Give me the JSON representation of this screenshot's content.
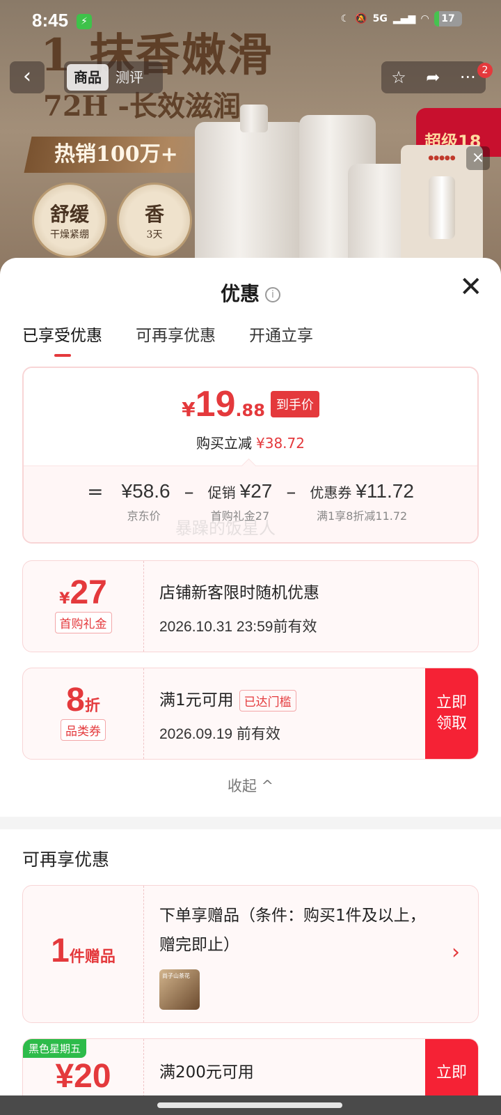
{
  "status_bar": {
    "time": "8:45",
    "network": "5G",
    "battery": "17",
    "battery_level": 0.17
  },
  "banner": {
    "headline": "1 抹香嫩滑",
    "subline": "72H -长效滋润",
    "ribbon": "热销100万+",
    "badge1_big": "舒缓",
    "badge1_small": "干燥紧绷",
    "badge2_big": "香",
    "badge2_small": "3天",
    "red_tag": "超级18"
  },
  "nav": {
    "tabs": [
      {
        "label": "商品"
      },
      {
        "label": "测评"
      }
    ],
    "cart_badge": "2"
  },
  "sheet": {
    "title": "优惠",
    "tabs": [
      {
        "label": "已享受优惠"
      },
      {
        "label": "可再享优惠"
      },
      {
        "label": "开通立享"
      }
    ]
  },
  "summary": {
    "currency": "¥",
    "price_int": "19",
    "price_dec": ".88",
    "price_tag": "到手价",
    "reduce_label": "购买立减",
    "reduce_value": "¥38.72",
    "equals": "=",
    "minus": "–",
    "terms": [
      {
        "prefix": "",
        "value": "¥58.6",
        "label": "京东价"
      },
      {
        "prefix": "促销",
        "value": "¥27",
        "label": "首购礼金27"
      },
      {
        "prefix": "优惠券",
        "value": "¥11.72",
        "label": "满1享8折减11.72"
      }
    ]
  },
  "watermark": "暴躁的饭星人",
  "coupons": [
    {
      "amount_prefix": "¥",
      "amount": "27",
      "amount_suffix": "",
      "kind": "首购礼金",
      "title": "店铺新客限时随机优惠",
      "valid": "2026.10.31 23:59前有效"
    },
    {
      "amount_prefix": "",
      "amount": "8",
      "amount_suffix": "折",
      "kind": "品类券",
      "title": "满1元可用",
      "tip": "已达门槛",
      "valid": "2026.09.19 前有效",
      "action": "立即领取"
    }
  ],
  "collapse_label": "收起 ^",
  "more_section": {
    "title": "可再享优惠",
    "gift": {
      "amount": "1",
      "suffix": "件赠品",
      "title": "下单享赠品（条件：购买1件及以上，赠完即止）",
      "thumb_text": "尚子山茶花"
    },
    "next": {
      "ribbon": "黑色星期五",
      "amount": "¥20",
      "title": "满200元可用",
      "action": "立即"
    }
  }
}
